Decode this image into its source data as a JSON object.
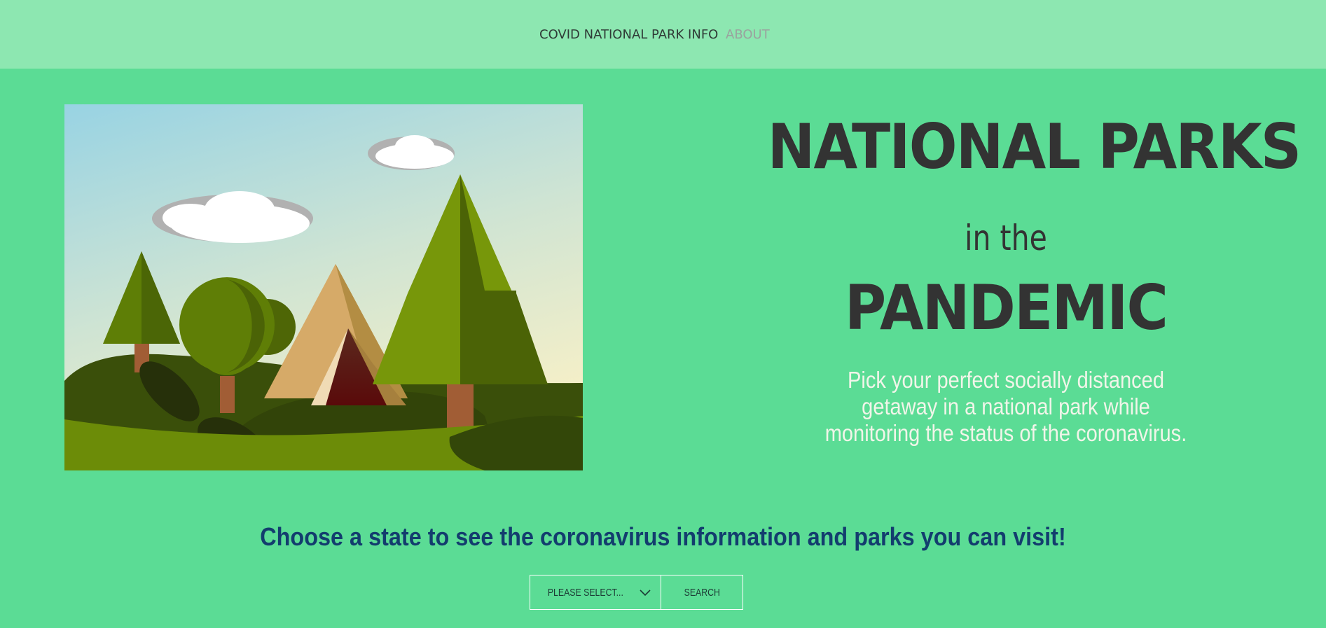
{
  "nav": {
    "home_label": "COVID NATIONAL PARK INFO",
    "about_label": "ABOUT"
  },
  "hero": {
    "title_line1": "NATIONAL PARKS",
    "title_line2": "in the",
    "title_line3": "PANDEMIC",
    "tagline": "Pick your perfect socially distanced getaway in a national park while monitoring the status of the coronavirus."
  },
  "search": {
    "prompt": "Choose a state to see the coronavirus information and parks you can visit!",
    "select_label": "PLEASE SELECT...",
    "button_label": "SEARCH"
  },
  "colors": {
    "background": "#5bdc95",
    "navbar": "#8de7b1",
    "title": "#333333",
    "prompt": "#133d6e",
    "tagline": "#f1f5e9"
  },
  "icons": [
    "chevron-down-icon"
  ]
}
